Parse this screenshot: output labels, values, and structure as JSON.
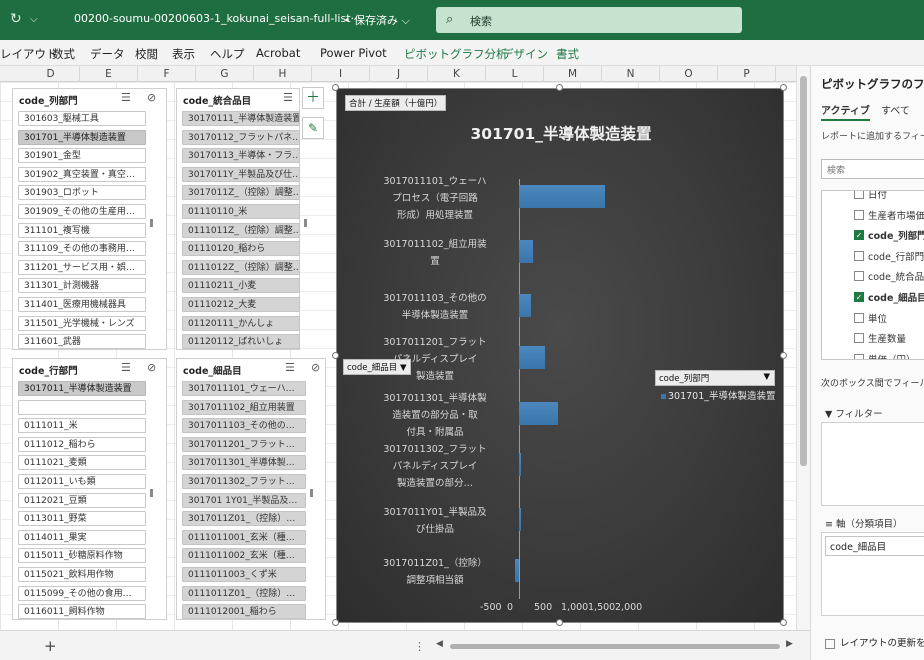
{
  "titlebar": {
    "filename": "00200-soumu-00200603-1_kokunai_seisan-full-list···",
    "save_status": "• 保存済み ⌵",
    "search_placeholder": "検索",
    "redo_icon": "↻",
    "dropdown_icon": "⌵"
  },
  "ribbon": {
    "tabs": [
      {
        "label": "レイアウト",
        "ctx": false
      },
      {
        "label": "数式",
        "ctx": false
      },
      {
        "label": "データ",
        "ctx": false
      },
      {
        "label": "校閲",
        "ctx": false
      },
      {
        "label": "表示",
        "ctx": false
      },
      {
        "label": "ヘルプ",
        "ctx": false
      },
      {
        "label": "Acrobat",
        "ctx": false
      },
      {
        "label": "Power Pivot",
        "ctx": false
      },
      {
        "label": "ピボットグラフ分析",
        "ctx": true
      },
      {
        "label": "デザイン",
        "ctx": true
      },
      {
        "label": "書式",
        "ctx": true
      }
    ]
  },
  "columns": [
    "D",
    "E",
    "F",
    "G",
    "H",
    "I",
    "J",
    "K",
    "L",
    "M",
    "N",
    "O",
    "P"
  ],
  "slicers": {
    "retsu_bumon": {
      "header": "code_列部門",
      "items": [
        "301603_駆械工具",
        "301701_半導体製造装置",
        "301901_金型",
        "301902_真空装置・真空…",
        "301903_ロボット",
        "301909_その他の生産用…",
        "311101_複写機",
        "311109_その他の事務用…",
        "311201_サービス用・娯…",
        "311301_計測機器",
        "311401_医療用機械器具",
        "311501_光学機械・レンズ",
        "311601_武器"
      ]
    },
    "tougou": {
      "header": "code_統合品目",
      "items": [
        "30170111_半導体製造装置",
        "30170112_フラットパネ…",
        "30170113_半導体・フラ…",
        "3017011Y_半製品及び仕…",
        "3017011Z_（控除）調整…",
        "01110110_米",
        "0111011Z_（控除）調整…",
        "01110120_稲わら",
        "0111012Z_（控除）調整…",
        "01110211_小麦",
        "01110212_大麦",
        "01120111_かんしょ",
        "01120112_ばれいしょ"
      ]
    },
    "gyou_bumon": {
      "header": "code_行部門",
      "items": [
        "3017011_半導体製造装置",
        "",
        "0111011_米",
        "0111012_稲わら",
        "0111021_麦類",
        "0112011_いも類",
        "0112021_豆類",
        "0113011_野菜",
        "0114011_果実",
        "0115011_砂糖原料作物",
        "0115021_飲料用作物",
        "0115099_その他の食用…",
        "0116011_飼料作物"
      ]
    },
    "saibu": {
      "header": "code_細品目",
      "items": [
        "3017011101_ウェーハ…",
        "3017011102_組立用装置",
        "3017011103_その他の…",
        "3017011201_フラット…",
        "3017011301_半導体製…",
        "3017011302_フラット…",
        "301701 1Y01_半製品及…",
        "3017011Z01_（控除）…",
        "0111011001_玄米（種…",
        "0111011002_玄米（種…",
        "0111011003_くず米",
        "0111011Z01_（控除）…",
        "0111012001_稲わら"
      ]
    }
  },
  "chart": {
    "value_field_button": "合計 / 生産額（十億円）",
    "axis_field_button": "code_細品目 ▼",
    "legend_field_button": "code_列部門",
    "legend_series": "301701_半導体製造装置",
    "legend_filter_icon": "▼"
  },
  "chart_data": {
    "type": "bar",
    "orientation": "horizontal",
    "title": "301701_半導体製造装置",
    "categories": [
      "3017011101_ウェーハプロセス（電子回路形成）用処理装置",
      "3017011102_組立用装置",
      "3017011103_その他の半導体製造装置",
      "3017011201_フラットパネルディスプレイ製造装置",
      "3017011301_半導体製造装置の部分品・取付具・附属品",
      "3017011302_フラットパネルディスプレイ製造装置の部分…",
      "3017011Y01_半製品及び仕掛品",
      "3017011Z01_（控除）調整項相当額"
    ],
    "category_lines": [
      [
        "3017011101_ウェーハ",
        "プロセス（電子回路",
        "形成）用処理装置"
      ],
      [
        "3017011102_組立用装",
        "置"
      ],
      [
        "3017011103_その他の",
        "半導体製造装置"
      ],
      [
        "3017011201_フラット",
        "パネルディスプレイ",
        "製造装置"
      ],
      [
        "3017011301_半導体製",
        "造装置の部分品・取",
        "付具・附属品"
      ],
      [
        "3017011302_フラット",
        "パネルディスプレイ",
        "製造装置の部分…"
      ],
      [
        "3017011Y01_半製品及",
        "び仕掛品"
      ],
      [
        "3017011Z01_（控除）",
        "調整項相当額"
      ]
    ],
    "series": [
      {
        "name": "301701_半導体製造装置",
        "values": [
          1600,
          250,
          230,
          490,
          730,
          40,
          10,
          -70
        ]
      }
    ],
    "xlim": [
      -500,
      2000
    ],
    "x_ticks": [
      "-500",
      "0",
      "500",
      "1,000",
      "1,500",
      "2,000"
    ],
    "x_tick_values": [
      -500,
      0,
      500,
      1000,
      1500,
      2000
    ],
    "legend_position": "right",
    "grid": false,
    "bar_color": "#3a75ab"
  },
  "pane": {
    "title": "ピボットグラフのフィールド",
    "tabs": [
      "アクティブ",
      "すべて"
    ],
    "hint": "レポートに追加するフィールドを選択してください:",
    "search_placeholder": "検索",
    "fields": [
      {
        "label": "日付",
        "checked": false
      },
      {
        "label": "生産者市場価格",
        "checked": false
      },
      {
        "label": "code_列部門",
        "checked": true
      },
      {
        "label": "code_行部門",
        "checked": false
      },
      {
        "label": "code_統合品目",
        "checked": false
      },
      {
        "label": "code_細品目",
        "checked": true
      },
      {
        "label": "単位",
        "checked": false
      },
      {
        "label": "生産数量",
        "checked": false
      },
      {
        "label": "単価（円）",
        "checked": false
      }
    ],
    "drag_hint": "次のボックス間でフィールドをドラッグしてください:",
    "filter_label": "▼ フィルター",
    "axis_label": "≡ 軸（分類項目）",
    "axis_item": "code_細品目",
    "defer_label": "レイアウトの更新を保留する"
  },
  "bottom": {
    "add_sheet": "+"
  }
}
